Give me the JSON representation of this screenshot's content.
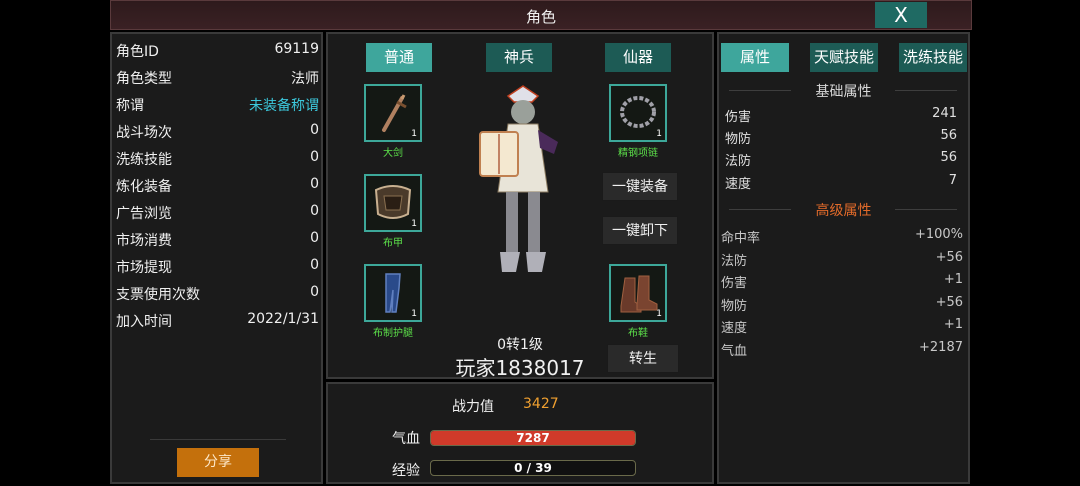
{
  "window": {
    "title": "角色",
    "close_label": "X"
  },
  "profile": {
    "rows": [
      {
        "key": "角色ID",
        "value": "69119"
      },
      {
        "key": "角色类型",
        "value": "法师"
      },
      {
        "key": "称谓",
        "value": "未装备称谓"
      },
      {
        "key": "战斗场次",
        "value": "0"
      },
      {
        "key": "洗练技能",
        "value": "0"
      },
      {
        "key": "炼化装备",
        "value": "0"
      },
      {
        "key": "广告浏览",
        "value": "0"
      },
      {
        "key": "市场消费",
        "value": "0"
      },
      {
        "key": "市场提现",
        "value": "0"
      },
      {
        "key": "支票使用次数",
        "value": "0"
      },
      {
        "key": "加入时间",
        "value": "2022/1/31"
      }
    ],
    "share_label": "分享"
  },
  "equipment": {
    "tabs": [
      "普通",
      "神兵",
      "仙器"
    ],
    "slots": [
      {
        "label": "大剑",
        "count": "1",
        "icon": "sword-icon"
      },
      {
        "label": "布甲",
        "count": "1",
        "icon": "armor-icon"
      },
      {
        "label": "布制护腿",
        "count": "1",
        "icon": "leggings-icon"
      },
      {
        "label": "精钢项链",
        "count": "1",
        "icon": "necklace-icon"
      },
      {
        "label": "布鞋",
        "count": "1",
        "icon": "boots-icon"
      }
    ],
    "equip_all_label": "一键装备",
    "unequip_all_label": "一键卸下",
    "rebirth_label": "转生",
    "level_text": "0转1级",
    "player_name": "玩家1838017"
  },
  "status": {
    "power_label": "战力值",
    "power_value": "3427",
    "hp_label": "气血",
    "hp_text": "7287",
    "hp_fill": 1.0,
    "exp_label": "经验",
    "exp_text": "0 / 39",
    "exp_fill": 0.0
  },
  "attributes": {
    "tabs": [
      "属性",
      "天赋技能",
      "洗练技能"
    ],
    "basic_title": "基础属性",
    "basic": [
      {
        "key": "伤害",
        "value": "241"
      },
      {
        "key": "物防",
        "value": "56"
      },
      {
        "key": "法防",
        "value": "56"
      },
      {
        "key": "速度",
        "value": "7"
      }
    ],
    "advanced_title": "高级属性",
    "advanced": [
      {
        "key": "命中率",
        "value": "+100%"
      },
      {
        "key": "法防",
        "value": "+56"
      },
      {
        "key": "伤害",
        "value": "+1"
      },
      {
        "key": "物防",
        "value": "+56"
      },
      {
        "key": "速度",
        "value": "+1"
      },
      {
        "key": "气血",
        "value": "+2187"
      }
    ]
  },
  "colors": {
    "accent": "#3ea69c",
    "tab": "#1d5b55",
    "hp": "#d03a2a",
    "exp": "#c89a20",
    "power": "#f0a030",
    "advanced_title": "#e06a2a",
    "share": "#c4700c"
  }
}
